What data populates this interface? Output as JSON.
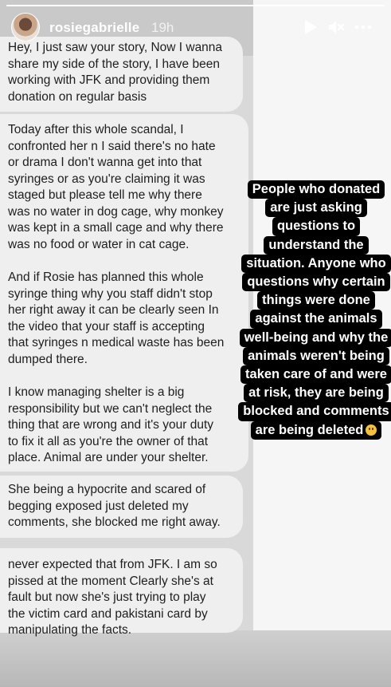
{
  "story": {
    "username": "rosiegabrielle",
    "time_ago": "19h",
    "progress_fraction": 1.0,
    "icons": [
      "avatar",
      "play-icon",
      "mute-icon",
      "more-icon"
    ]
  },
  "messages": [
    {
      "text": "Hey, I just saw your story, Now I wanna\nshare my side of the story, I have been\nworking with JFK and providing them\ndonation on regular basis"
    },
    {
      "paragraphs": [
        "Today after this whole scandal, I\nconfronted her n I said there's no hate\nor drama I don't wanna get into that\nsyringes or as you're claiming it was\nstaged but please tell me why there\nwas no water in dog cage, why monkey\nwas kept in a small cage and why there\nwas no food or water in cat cage.",
        "And if Rosie has planned this whole\nsyringe thing why you staff didn't stop\nher right away it can be clearly seen In\nthe video that your staff is accepting\nthat syringes n medical waste has been\ndumped there.",
        "I know managing shelter is a big\nresponsibility but we can't neglect the\nthing that are wrong and it's your duty\nto fix it all as you're the owner of that\nplace. Animal are under your shelter."
      ]
    },
    {
      "text": "She being a hypocrite and scared of\nbegging exposed just deleted my\ncomments, she blocked me right away."
    },
    {
      "text": "never expected that from JFK. I am so\npissed at the moment Clearly she's at\nfault but now she's just trying to play\nthe victim card and pakistani card by\nmanipulating the facts."
    }
  ],
  "caption": {
    "lines": [
      "People who donated",
      "are just asking",
      "questions to",
      "understand the",
      "situation. Anyone who",
      "questions why certain",
      "things were done",
      "against the animals",
      "well-being and why the",
      "animals weren't being",
      "taken care of and were",
      "at risk, they are being",
      "blocked and comments",
      "are being deleted"
    ],
    "trailing_emoji": "flushed-face-emoji"
  },
  "colors": {
    "bubble": "#efefef",
    "caption_bg": "#000000",
    "caption_text": "#ffffff",
    "header_text": "#ffffff"
  }
}
